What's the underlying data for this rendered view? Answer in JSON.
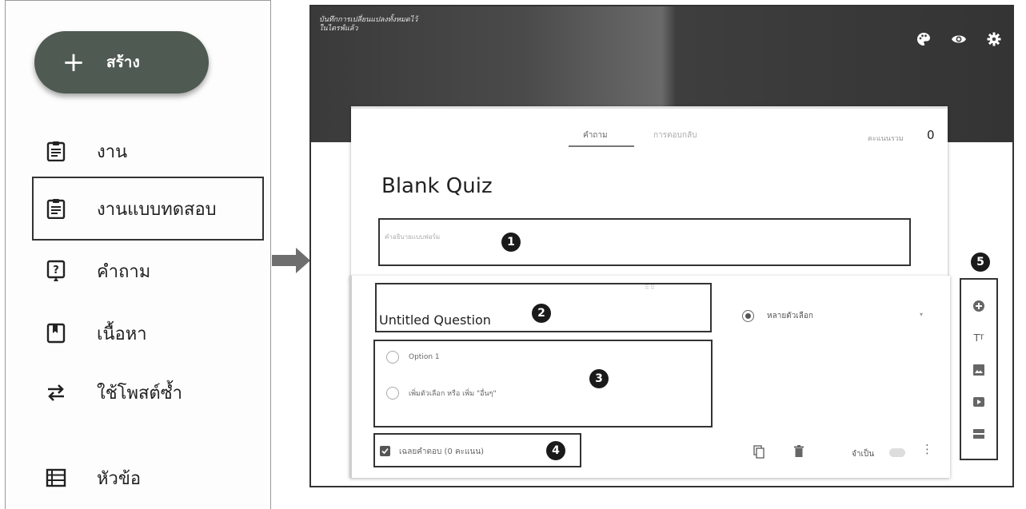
{
  "sidebar": {
    "create_label": "สร้าง",
    "items": [
      {
        "label": "งาน",
        "icon": "assignment-icon"
      },
      {
        "label": "งานแบบทดสอบ",
        "icon": "quiz-assignment-icon"
      },
      {
        "label": "คำถาม",
        "icon": "question-icon"
      },
      {
        "label": "เนื้อหา",
        "icon": "material-icon"
      },
      {
        "label": "ใช้โพสต์ซ้ำ",
        "icon": "reuse-post-icon"
      },
      {
        "label": "หัวข้อ",
        "icon": "topic-icon"
      }
    ]
  },
  "form": {
    "header_title_line1": "บันทึกการเปลี่ยนแปลงทั้งหมดไว้",
    "header_title_line2": "ในไดรฟ์แล้ว",
    "tabs": [
      {
        "label": "คำถาม",
        "active": true
      },
      {
        "label": "การตอบกลับ",
        "active": false
      }
    ],
    "total_points_label": "คะแนนรวม",
    "total_points_value": "0",
    "title": "Blank Quiz",
    "description_placeholder": "คำอธิบายแบบฟอร์ม",
    "question": {
      "title": "Untitled Question",
      "type": "หลายตัวเลือก",
      "options": [
        "Option 1",
        "เพิ่มตัวเลือก หรือ  เพิ่ม \"อื่นๆ\""
      ],
      "answer_key": "เฉลยคำตอบ  (0 คะแนน)",
      "required_label": "จำเป็น"
    }
  },
  "callouts": [
    "1",
    "2",
    "3",
    "4",
    "5"
  ],
  "colors": {
    "create_button": "#4f5a52",
    "banner": "#3a3a3a",
    "callout_badge": "#1a1a1a"
  }
}
